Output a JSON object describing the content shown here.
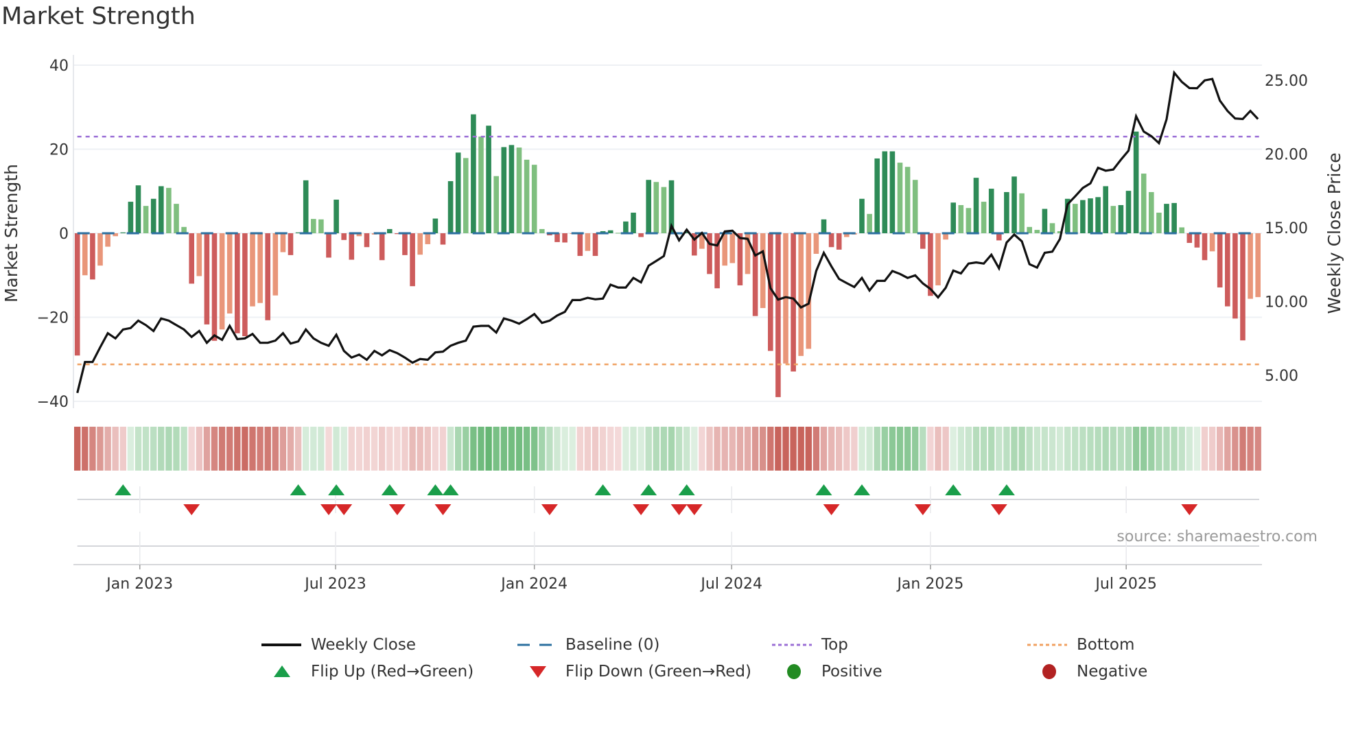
{
  "title": "Market Strength",
  "source": "source: sharemaestro.com",
  "legend": {
    "weekly_close": "Weekly Close",
    "baseline": "Baseline (0)",
    "top": "Top",
    "bottom": "Bottom",
    "flip_up": "Flip Up (Red→Green)",
    "flip_down": "Flip Down (Green→Red)",
    "positive": "Positive",
    "negative": "Negative"
  },
  "colors": {
    "pos_strong": "#2e8b57",
    "pos_weak": "#7fbf7f",
    "neg_strong": "#cd5c5c",
    "neg_weak": "#e9967a",
    "baseline": "#2b6f9f",
    "top": "#9b6fd6",
    "bottom": "#f0a060",
    "flip_up": "#1a9e4a",
    "flip_down": "#d62728",
    "positive": "#228b22",
    "negative": "#b22222",
    "close": "#111111"
  },
  "chart_data": {
    "type": "bar",
    "title": "Market Strength",
    "ylabel": "Market Strength",
    "y2label": "Weekly Close Price",
    "ylim": [
      -40,
      40
    ],
    "y2lim": [
      5,
      25
    ],
    "yticks": [
      {
        "v": 40,
        "label": "40"
      },
      {
        "v": 20,
        "label": "20"
      },
      {
        "v": 0,
        "label": "0"
      },
      {
        "v": -20,
        "label": "−20"
      },
      {
        "v": -40,
        "label": "−40"
      }
    ],
    "y2ticks": [
      {
        "v": 25,
        "label": "25.00"
      },
      {
        "v": 20,
        "label": "20.00"
      },
      {
        "v": 15,
        "label": "15.00"
      },
      {
        "v": 10,
        "label": "10.00"
      },
      {
        "v": 5,
        "label": "5.00"
      }
    ],
    "xticks": [
      {
        "week": 8.2,
        "label": "Jan 2023"
      },
      {
        "week": 33.9,
        "label": "Jul 2023"
      },
      {
        "week": 60.0,
        "label": "Jan 2024"
      },
      {
        "week": 85.9,
        "label": "Jul 2024"
      },
      {
        "week": 112.0,
        "label": "Jan 2025"
      },
      {
        "week": 137.7,
        "label": "Jul 2025"
      }
    ],
    "top_level": 23,
    "bottom_level": -31.2,
    "baseline": 0,
    "strength": [
      -29.1,
      -10,
      -11,
      -7.7,
      -3.2,
      -0.7,
      0.2,
      7.5,
      11.4,
      6.5,
      8.2,
      11.2,
      10.8,
      7,
      1.5,
      -12,
      -10.2,
      -21.7,
      -25.6,
      -22.9,
      -19.1,
      -23.8,
      -24.5,
      -17.4,
      -16.6,
      -20.7,
      -14.8,
      -4.5,
      -5.2,
      0.2,
      12.6,
      3.4,
      3.3,
      -5.8,
      8,
      -1.6,
      -6.3,
      -0.7,
      -3.3,
      -0.3,
      -6.4,
      1,
      -0.2,
      -5.2,
      -12.6,
      -5.1,
      -2.6,
      3.5,
      -2.7,
      12.4,
      19.2,
      17.9,
      28.3,
      23,
      25.6,
      13.6,
      20.5,
      21,
      20.4,
      17.5,
      16.3,
      1,
      -0.5,
      -2.1,
      -2.2,
      -0.1,
      -5.4,
      -4.2,
      -5.4,
      0.5,
      0.7,
      0.1,
      2.8,
      4.9,
      -0.9,
      12.7,
      12.2,
      11,
      12.6,
      -0.2,
      0.3,
      -5.3,
      -3.7,
      -9.7,
      -13.1,
      -7.7,
      -7.1,
      -12.4,
      -9.7,
      -19.7,
      -17.8,
      -28,
      -39,
      -31,
      -32.9,
      -29.2,
      -27.5,
      -4.9,
      3.3,
      -3.3,
      -3.9,
      -0.9,
      -0.3,
      8.2,
      4.6,
      17.8,
      19.5,
      19.5,
      16.8,
      15.8,
      12.7,
      -3.7,
      -14.9,
      -12.4,
      -1.5,
      7.3,
      6.7,
      6,
      13.2,
      7.5,
      10.6,
      -1.7,
      9.8,
      13.5,
      9.5,
      1.5,
      0.8,
      5.8,
      2.4,
      0.5,
      8.2,
      7,
      7.9,
      8.3,
      8.6,
      11.2,
      6.5,
      6.7,
      10.1,
      24.2,
      14.2,
      9.8,
      4.9,
      7,
      7.2,
      1.4,
      -2.3,
      -3.4,
      -6.4,
      -4.3,
      -12.9,
      -17.4,
      -20.3,
      -25.5,
      -15.6,
      -15.2
    ],
    "weekly_close": [
      3.8,
      5.9,
      5.9,
      6.9,
      7.85,
      7.5,
      8.1,
      8.2,
      8.7,
      8.4,
      8.0,
      8.85,
      8.7,
      8.4,
      8.1,
      7.6,
      8.0,
      7.2,
      7.7,
      7.4,
      8.35,
      7.45,
      7.5,
      7.8,
      7.2,
      7.2,
      7.35,
      7.85,
      7.15,
      7.3,
      8.1,
      7.5,
      7.2,
      7.0,
      7.75,
      6.65,
      6.2,
      6.4,
      6.05,
      6.65,
      6.35,
      6.7,
      6.5,
      6.2,
      5.85,
      6.1,
      6.05,
      6.55,
      6.6,
      7.0,
      7.2,
      7.35,
      8.3,
      8.35,
      8.35,
      7.9,
      8.85,
      8.7,
      8.5,
      8.8,
      9.15,
      8.55,
      8.7,
      9.05,
      9.3,
      10.1,
      10.1,
      10.25,
      10.15,
      10.2,
      11.14,
      10.95,
      10.95,
      11.6,
      11.3,
      12.43,
      12.75,
      13.08,
      15.13,
      14.15,
      14.87,
      14.2,
      14.65,
      13.9,
      13.8,
      14.75,
      14.8,
      14.3,
      14.25,
      13.12,
      13.4,
      10.9,
      10.13,
      10.3,
      10.2,
      9.6,
      9.85,
      12.07,
      13.3,
      12.38,
      11.53,
      11.25,
      10.98,
      11.6,
      10.75,
      11.4,
      11.4,
      12.07,
      11.87,
      11.6,
      11.77,
      11.23,
      10.85,
      10.28,
      10.93,
      12.1,
      11.9,
      12.57,
      12.65,
      12.57,
      13.17,
      12.25,
      14.0,
      14.54,
      14.08,
      12.53,
      12.3,
      13.3,
      13.38,
      14.24,
      16.59,
      17.13,
      17.7,
      18.01,
      19.07,
      18.87,
      18.95,
      19.61,
      20.23,
      22.56,
      21.52,
      21.21,
      20.74,
      22.36,
      25.51,
      24.89,
      24.47,
      24.46,
      24.99,
      25.09,
      23.62,
      22.92,
      22.41,
      22.37,
      22.92,
      22.37
    ],
    "flip_up_weeks": [
      6,
      29,
      34,
      41,
      47,
      49,
      69,
      75,
      80,
      98,
      103,
      115,
      122
    ],
    "flip_down_weeks": [
      15,
      33,
      35,
      42,
      48,
      62,
      74,
      79,
      81,
      99,
      111,
      121,
      146
    ],
    "grid": true,
    "legend_position": "bottom"
  }
}
